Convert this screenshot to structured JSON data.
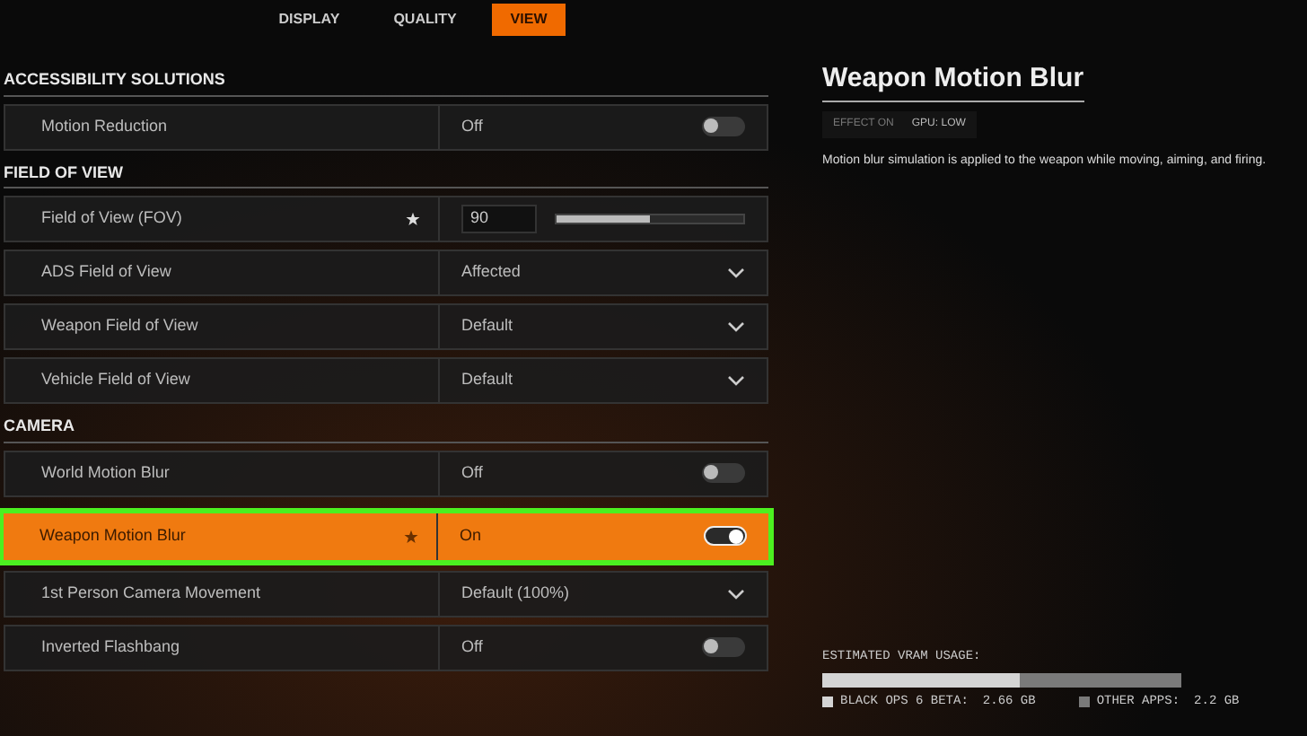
{
  "tabs": [
    {
      "label": "DISPLAY",
      "selected": false
    },
    {
      "label": "QUALITY",
      "selected": false
    },
    {
      "label": "VIEW",
      "selected": true
    }
  ],
  "sections": [
    {
      "title": "ACCESSIBILITY SOLUTIONS",
      "rows": [
        {
          "kind": "toggle",
          "label": "Motion Reduction",
          "value": "Off",
          "on": false,
          "favorite": false,
          "selected": false
        }
      ]
    },
    {
      "title": "FIELD OF VIEW",
      "rows": [
        {
          "kind": "slider",
          "label": "Field of View (FOV)",
          "value": "90",
          "level": 0.5,
          "favorite": true,
          "selected": false
        },
        {
          "kind": "dropdown",
          "label": "ADS Field of View",
          "value": "Affected",
          "favorite": false,
          "selected": false
        },
        {
          "kind": "dropdown",
          "label": "Weapon Field of View",
          "value": "Default",
          "favorite": false,
          "selected": false
        },
        {
          "kind": "dropdown",
          "label": "Vehicle Field of View",
          "value": "Default",
          "favorite": false,
          "selected": false
        }
      ]
    },
    {
      "title": "CAMERA",
      "rows": [
        {
          "kind": "toggle",
          "label": "World Motion Blur",
          "value": "Off",
          "on": false,
          "favorite": false,
          "selected": false
        },
        {
          "kind": "toggle",
          "label": "Weapon Motion Blur",
          "value": "On",
          "on": true,
          "favorite": true,
          "selected": true
        },
        {
          "kind": "dropdown",
          "label": "1st Person Camera Movement",
          "value": "Default (100%)",
          "favorite": false,
          "selected": false
        },
        {
          "kind": "toggle",
          "label": "Inverted Flashbang",
          "value": "Off",
          "on": false,
          "favorite": false,
          "selected": false
        }
      ]
    }
  ],
  "detail": {
    "title": "Weapon Motion Blur",
    "tags": [
      "EFFECT ON",
      "GPU: LOW"
    ],
    "description": "Motion blur simulation is applied to the weapon while moving, aiming, and firing."
  },
  "vram": {
    "label": "ESTIMATED VRAM USAGE:",
    "segments": [
      {
        "name": "BLACK OPS 6 BETA:",
        "amount": "2.66 GB",
        "level": 0.55,
        "color": "#d4d4d4"
      },
      {
        "name": "OTHER APPS:",
        "amount": "2.2 GB",
        "level": 0.45,
        "color": "#7a7a7a"
      }
    ]
  }
}
